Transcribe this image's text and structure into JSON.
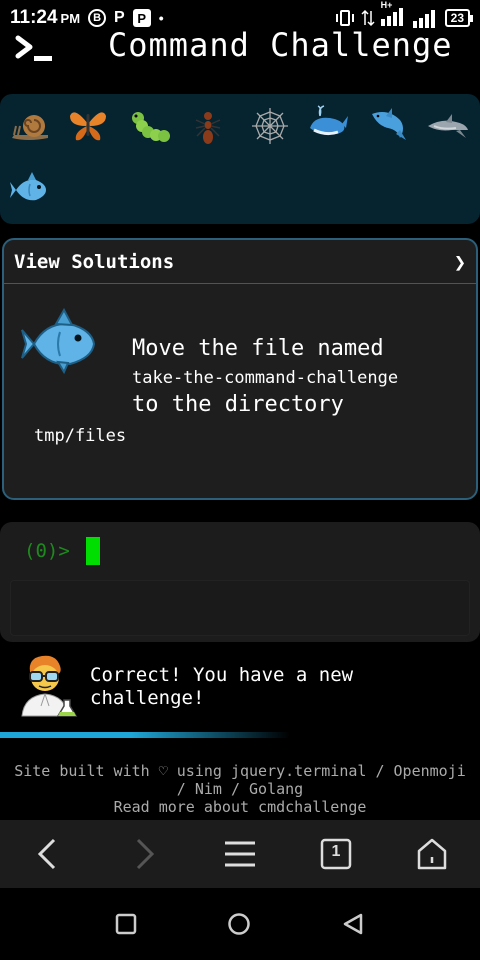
{
  "status_bar": {
    "time": "11:24",
    "ampm": "PM",
    "app_icons": [
      "B",
      "P",
      "P",
      "•"
    ],
    "network": "H+",
    "battery": "23"
  },
  "header": {
    "title": "Command Challenge",
    "logo": "terminal-prompt-icon"
  },
  "emoji_strip": {
    "icons": [
      "snail-icon",
      "butterfly-icon",
      "caterpillar-icon",
      "ant-icon",
      "spider-web-icon",
      "whale-icon",
      "dolphin-icon",
      "dolphin-gray-icon",
      "fish-icon"
    ]
  },
  "challenge": {
    "view_solutions_label": "View Solutions",
    "chevron": "❯",
    "line1": "Move the file named",
    "filename": "take-the-command-challenge",
    "line2": "to the directory",
    "directory": "tmp/files"
  },
  "terminal": {
    "prompt": "(0)>"
  },
  "feedback": {
    "message": "Correct! You have a new challenge!"
  },
  "footer": {
    "line1": "Site built with ♡ using jquery.terminal / Openmoji",
    "line2": "/ Nim / Golang",
    "line3": "Read more about cmdchallenge"
  },
  "browser_bar": {
    "tab_count": "1"
  },
  "colors": {
    "accent": "#1fa6d8",
    "strip_bg": "#062330",
    "card_border": "#2b5f7a",
    "cursor": "#00dd00",
    "prompt": "#1e8a1e"
  }
}
